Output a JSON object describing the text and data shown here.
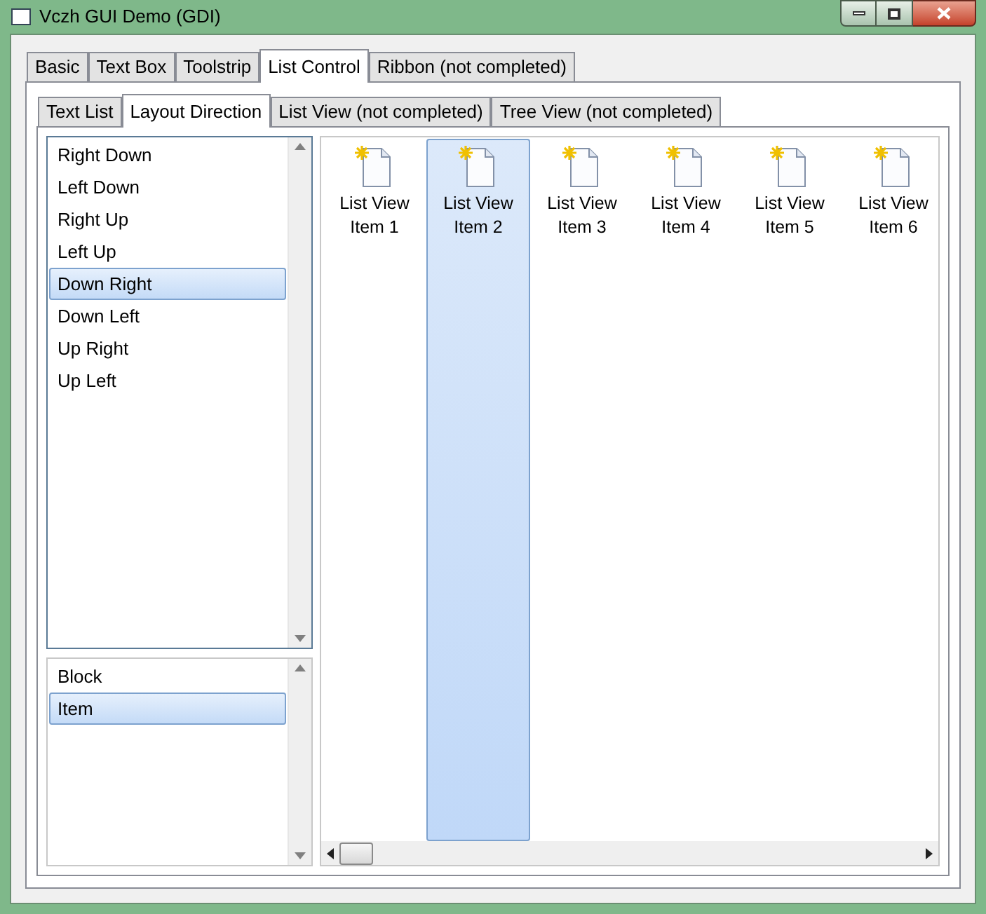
{
  "window": {
    "title": "Vczh GUI Demo (GDI)"
  },
  "tabs": [
    {
      "label": "Basic",
      "selected": false
    },
    {
      "label": "Text Box",
      "selected": false
    },
    {
      "label": "Toolstrip",
      "selected": false
    },
    {
      "label": "List Control",
      "selected": true
    },
    {
      "label": "Ribbon (not completed)",
      "selected": false
    }
  ],
  "subtabs": [
    {
      "label": "Text List",
      "selected": false
    },
    {
      "label": "Layout Direction",
      "selected": true
    },
    {
      "label": "List View (not completed)",
      "selected": false
    },
    {
      "label": "Tree View (not completed)",
      "selected": false
    }
  ],
  "direction_list": [
    {
      "label": "Right Down",
      "selected": false
    },
    {
      "label": "Left Down",
      "selected": false
    },
    {
      "label": "Right Up",
      "selected": false
    },
    {
      "label": "Left Up",
      "selected": false
    },
    {
      "label": "Down Right",
      "selected": true
    },
    {
      "label": "Down Left",
      "selected": false
    },
    {
      "label": "Up Right",
      "selected": false
    },
    {
      "label": "Up Left",
      "selected": false
    }
  ],
  "mode_list": [
    {
      "label": "Block",
      "selected": false
    },
    {
      "label": "Item",
      "selected": true
    }
  ],
  "list_view": [
    {
      "label": "List View Item 1",
      "selected": false
    },
    {
      "label": "List View Item 2",
      "selected": true
    },
    {
      "label": "List View Item 3",
      "selected": false
    },
    {
      "label": "List View Item 4",
      "selected": false
    },
    {
      "label": "List View Item 5",
      "selected": false
    },
    {
      "label": "List View Item 6",
      "selected": false
    }
  ]
}
